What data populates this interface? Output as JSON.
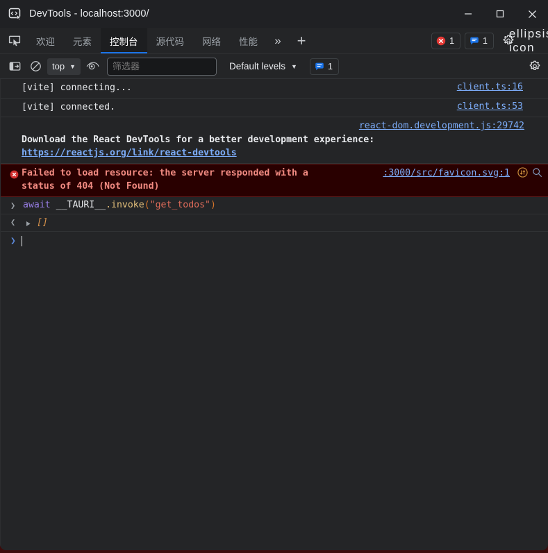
{
  "window": {
    "title": "DevTools - localhost:3000/",
    "icon": "devtools-icon",
    "controls": {
      "minimize": "—",
      "maximize": "□",
      "close": "✕"
    }
  },
  "tabbar": {
    "inspect_icon": "inspect-element-icon",
    "tabs": [
      {
        "label": "欢迎",
        "name": "welcome",
        "active": false
      },
      {
        "label": "元素",
        "name": "elements",
        "active": false
      },
      {
        "label": "控制台",
        "name": "console",
        "active": true
      },
      {
        "label": "源代码",
        "name": "sources",
        "active": false
      },
      {
        "label": "网络",
        "name": "network",
        "active": false
      },
      {
        "label": "性能",
        "name": "performance",
        "active": false
      }
    ],
    "more_label": "»",
    "add_label": "+",
    "error_count": "1",
    "message_count": "1",
    "settings_icon": "gear-icon",
    "overflow_icon": "ellipsis-icon"
  },
  "console_toolbar": {
    "sidebar_icon": "console-sidebar-icon",
    "clear_icon": "clear-console-icon",
    "context_value": "top",
    "context_caret": "▼",
    "eye_icon": "live-expression-eye-icon",
    "filter_placeholder": "筛选器",
    "filter_value": "",
    "levels_value": "Default levels",
    "levels_caret": "▼",
    "message_count": "1",
    "settings_icon": "gear-icon"
  },
  "console_rows": [
    {
      "name": "vite-connecting",
      "text": "[vite] connecting...",
      "source": "client.ts:16"
    },
    {
      "name": "vite-connected",
      "text": "[vite] connected.",
      "source": "client.ts:53"
    }
  ],
  "react_row": {
    "source": "react-dom.development.js:29742",
    "text_prefix": "Download the React DevTools for a better development experience: ",
    "link": "https://reactjs.org/link/react-devtools"
  },
  "error_row": {
    "icon": "error-circle-icon",
    "text": "Failed to load resource: the server responded with a status of 404 (Not Found)",
    "source": ":3000/src/favicon.svg:1",
    "network_icon": "network-request-icon",
    "search_icon": "search-icon"
  },
  "command_row": {
    "chevron": "❯",
    "keyword": "await",
    "identifier": " __TAURI__",
    "property": ".invoke",
    "open_paren": "(",
    "string": "\"get_todos\"",
    "close_paren": ")"
  },
  "result_row": {
    "back_chevron": "❮",
    "expand_icon": "expand-triangle-icon",
    "value": "[]"
  },
  "prompt_row": {
    "chevron": "❯",
    "value": ""
  },
  "colors": {
    "accent": "#1a73e8",
    "link": "#7cacf8",
    "error_bg": "#290000",
    "error_text": "#f28b82",
    "error_icon": "#e53935",
    "panel_bg": "#242527",
    "titlebar_bg": "#202124",
    "result_value": "#d7924b"
  }
}
